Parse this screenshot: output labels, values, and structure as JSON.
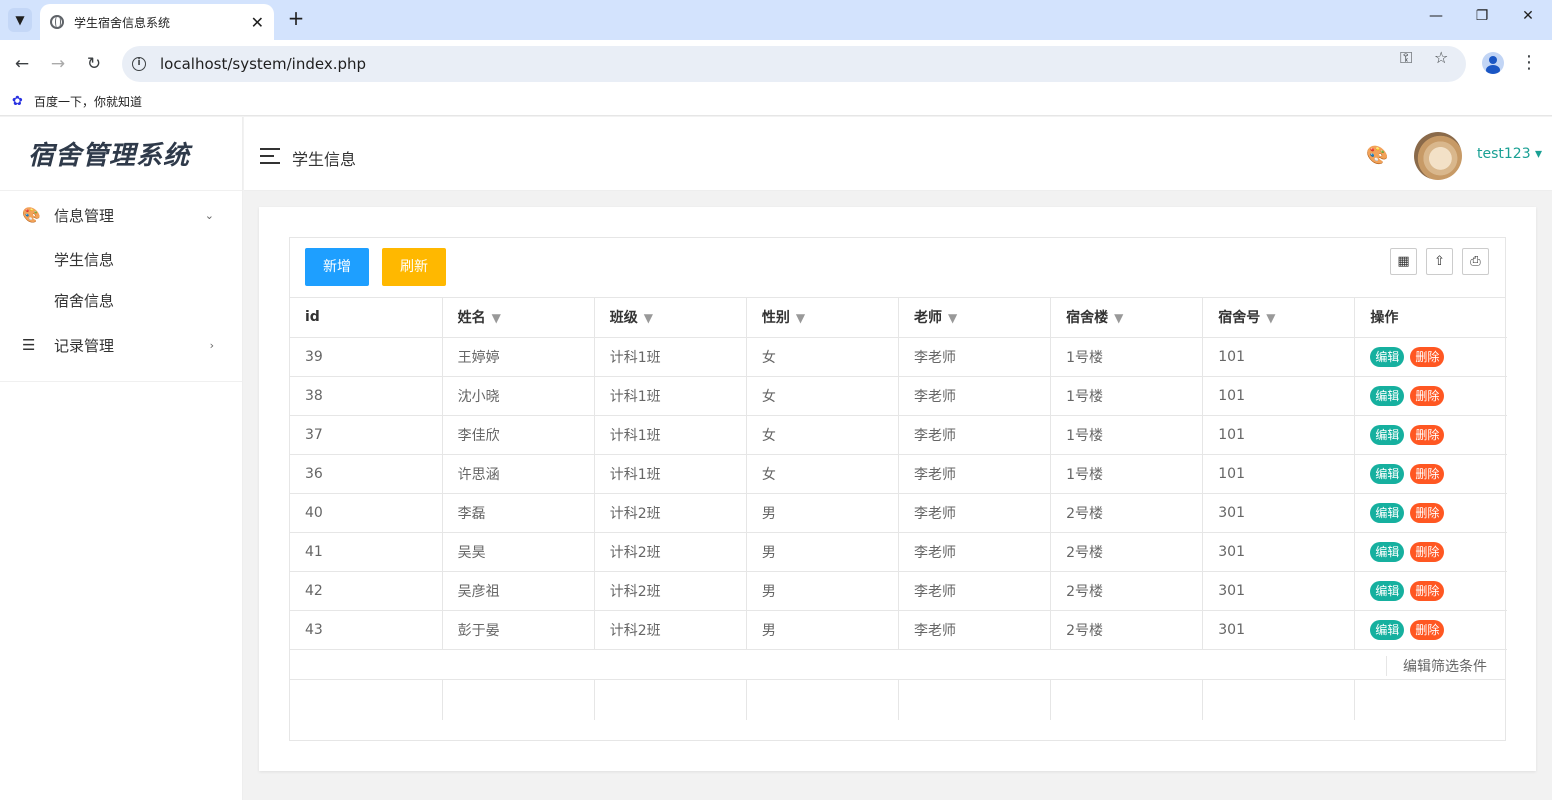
{
  "browser": {
    "tab_title": "学生宿舍信息系统",
    "url": "localhost/system/index.php",
    "bookmark_label": "百度一下，你就知道"
  },
  "sidebar": {
    "logo": "宿舍管理系统",
    "groups": [
      {
        "label": "信息管理",
        "icon": "palette-icon",
        "expanded": true,
        "items": [
          "学生信息",
          "宿舍信息"
        ]
      },
      {
        "label": "记录管理",
        "icon": "list-icon",
        "expanded": false,
        "items": []
      }
    ]
  },
  "header": {
    "title": "学生信息",
    "username": "test123"
  },
  "toolbar": {
    "add_label": "新增",
    "refresh_label": "刷新"
  },
  "table": {
    "columns": [
      "id",
      "姓名",
      "班级",
      "性别",
      "老师",
      "宿舍楼",
      "宿舍号",
      "操作"
    ],
    "edit_label": "编辑",
    "delete_label": "删除",
    "rows": [
      [
        "39",
        "王婷婷",
        "计科1班",
        "女",
        "李老师",
        "1号楼",
        "101"
      ],
      [
        "38",
        "沈小晓",
        "计科1班",
        "女",
        "李老师",
        "1号楼",
        "101"
      ],
      [
        "37",
        "李佳欣",
        "计科1班",
        "女",
        "李老师",
        "1号楼",
        "101"
      ],
      [
        "36",
        "许思涵",
        "计科1班",
        "女",
        "李老师",
        "1号楼",
        "101"
      ],
      [
        "40",
        "李磊",
        "计科2班",
        "男",
        "李老师",
        "2号楼",
        "301"
      ],
      [
        "41",
        "吴昊",
        "计科2班",
        "男",
        "李老师",
        "2号楼",
        "301"
      ],
      [
        "42",
        "吴彦祖",
        "计科2班",
        "男",
        "李老师",
        "2号楼",
        "301"
      ],
      [
        "43",
        "彭于晏",
        "计科2班",
        "男",
        "李老师",
        "2号楼",
        "301"
      ]
    ],
    "filter_edit_label": "编辑筛选条件"
  },
  "colors": {
    "primary": "#1e9fff",
    "warning": "#ffb800",
    "edit": "#16b09f",
    "danger": "#ff5722",
    "accent_text": "#1aa094"
  }
}
